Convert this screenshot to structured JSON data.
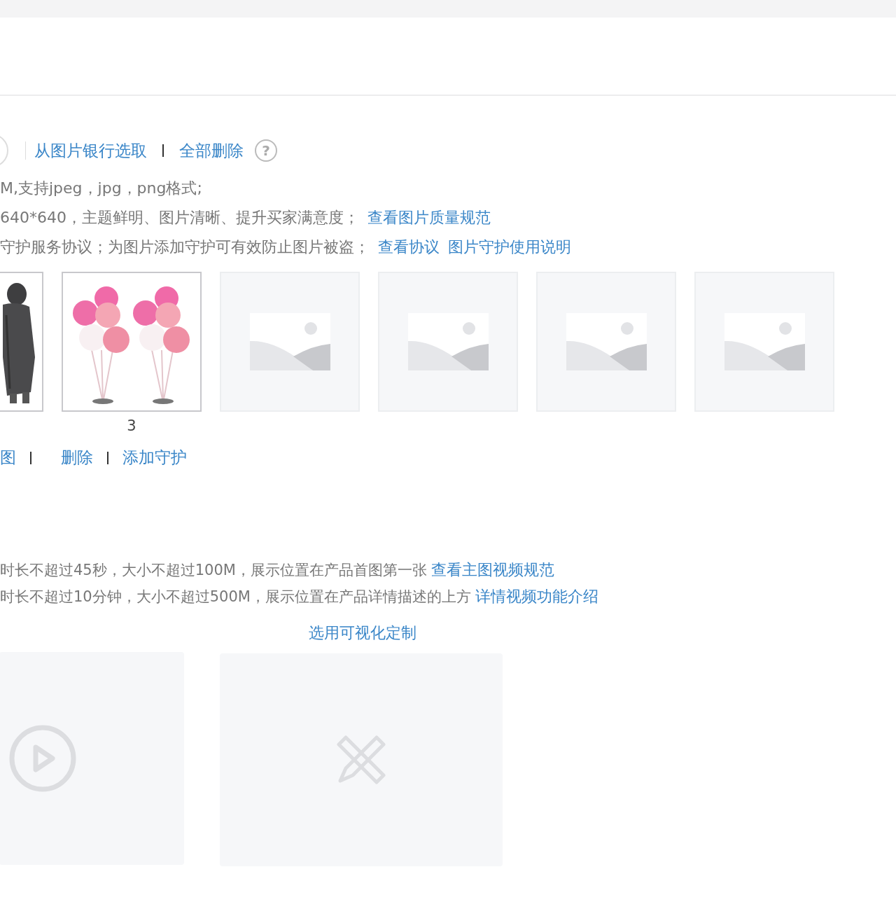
{
  "image_toolbar": {
    "links": [
      {
        "text": "从图片银行选取"
      },
      {
        "text": "全部删除"
      }
    ],
    "help": "?"
  },
  "image_notes": [
    {
      "text": "M,支持jpeg，jpg，png格式;"
    },
    {
      "text": "640*640，主题鲜明、图片清晰、提升买家满意度；",
      "links": [
        "查看图片质量规范"
      ]
    },
    {
      "text": "守护服务协议；为图片添加守护可有效防止图片被盗；",
      "links": [
        "查看协议",
        "图片守护使用说明"
      ]
    }
  ],
  "images": [
    {
      "kind": "coat"
    },
    {
      "kind": "balloons",
      "number": "3"
    },
    {
      "kind": "empty"
    },
    {
      "kind": "empty"
    },
    {
      "kind": "empty"
    },
    {
      "kind": "empty"
    }
  ],
  "image_actions": [
    "图",
    "删除",
    "添加守护"
  ],
  "video_notes": [
    {
      "text": "时长不超过45秒，大小不超过100M，展示位置在产品首图第一张",
      "link": "查看主图视频规范"
    },
    {
      "text": "时长不超过10分钟，大小不超过500M，展示位置在产品详情描述的上方",
      "link": "详情视频功能介绍"
    }
  ],
  "video_options": [
    {
      "kind": "video"
    },
    {
      "kind": "custom",
      "label": "选用可视化定制"
    }
  ]
}
